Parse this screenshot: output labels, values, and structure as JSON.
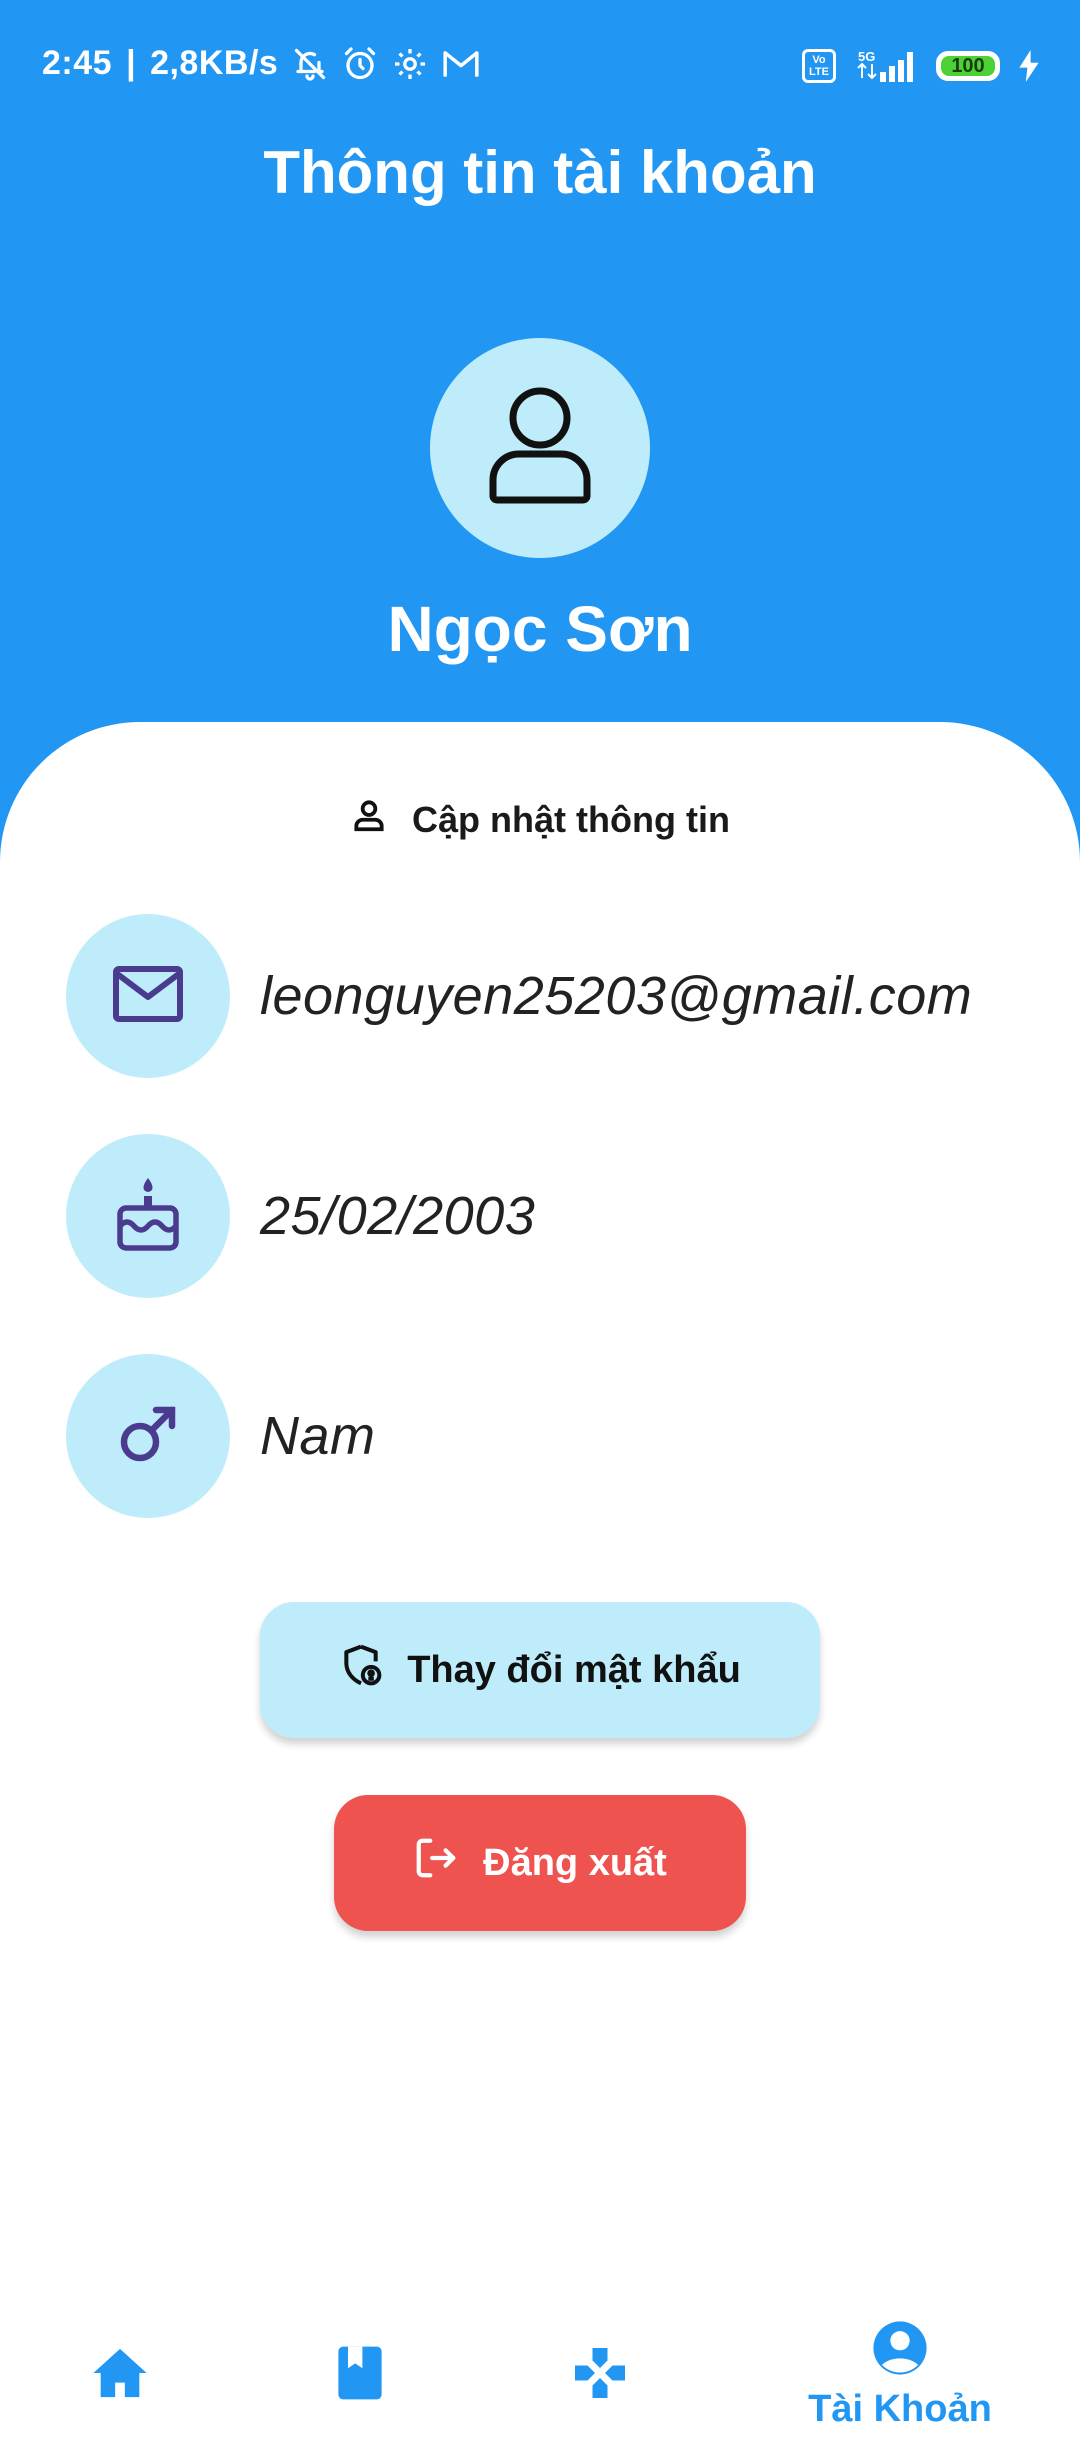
{
  "status_bar": {
    "time": "2:45",
    "network_speed": "2,8KB/s",
    "network_type": "5G",
    "volte_label": "Vo LTE",
    "battery_level": "100"
  },
  "header": {
    "title": "Thông tin tài khoản"
  },
  "profile": {
    "avatar_icon": "user-outline-icon",
    "name": "Ngọc Sơn"
  },
  "actions": {
    "update_info_label": "Cập nhật thông tin",
    "change_password_label": "Thay đổi mật khẩu",
    "logout_label": "Đăng xuất"
  },
  "info": [
    {
      "icon": "mail-icon",
      "value": "leonguyen25203@gmail.com"
    },
    {
      "icon": "cake-icon",
      "value": "25/02/2003"
    },
    {
      "icon": "male-gender-icon",
      "value": "Nam"
    }
  ],
  "bottom_nav": {
    "items": [
      {
        "icon": "home-icon",
        "label": ""
      },
      {
        "icon": "bookmark-book-icon",
        "label": ""
      },
      {
        "icon": "gamepad-icon",
        "label": ""
      },
      {
        "icon": "account-circle-icon",
        "label": "Tài Khoản",
        "active": true
      }
    ]
  },
  "colors": {
    "primary": "#2196F3",
    "accent_light": "#BEECFA",
    "danger": "#EF5350",
    "icon_purple": "#4A3B8F"
  }
}
